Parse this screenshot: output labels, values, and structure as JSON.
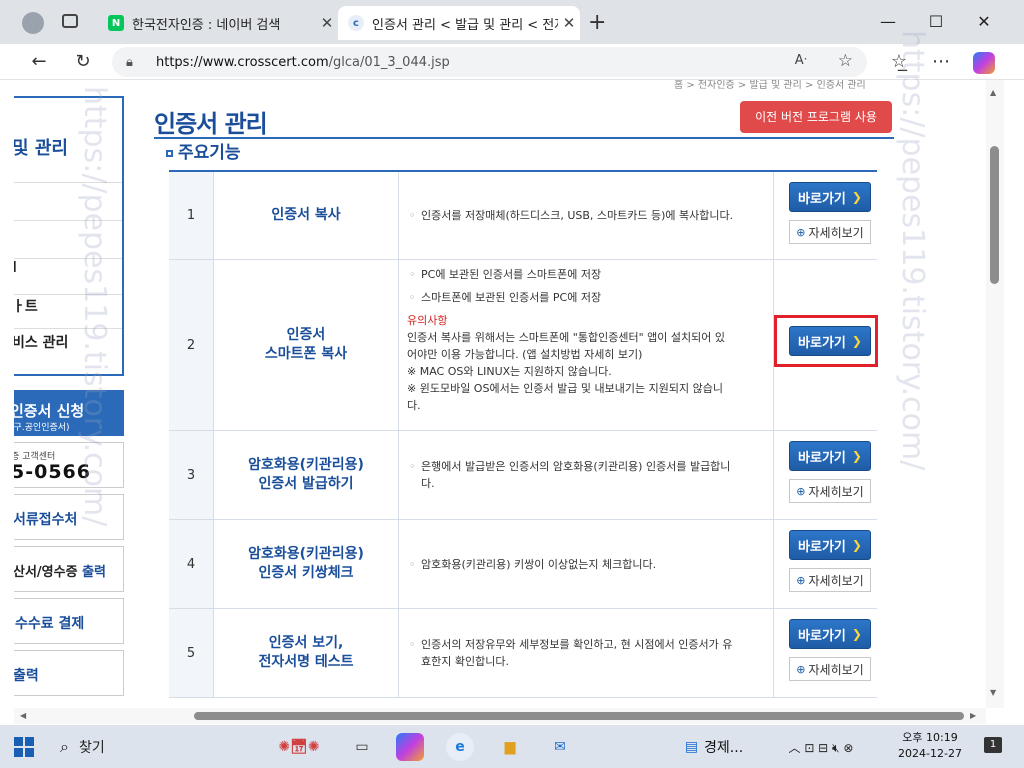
{
  "browser": {
    "tabs": [
      {
        "title": "한국전자인증 : 네이버 검색",
        "favicon": "N"
      },
      {
        "title": "인증서 관리 < 발급 및 관리 < 전자",
        "favicon": "c"
      }
    ],
    "url_host": "https://www.crosscert.com",
    "url_path": "/glca/01_3_044.jsp"
  },
  "sidebar": {
    "title": "및 관리",
    "items": [
      "l",
      "ㅏ트",
      "비스 관리"
    ],
    "apply_main": "인증서 신청",
    "apply_sub": "(구.공인인증서)",
    "cs_label": "증 고객센터",
    "cs_phone": "5-0566",
    "doc_label": "서류접수처",
    "tax_label": "산서/영수증",
    "tax_label_blue": "출력",
    "fee_label": "수수료 결제",
    "print_label": "출력"
  },
  "main": {
    "breadcrumb": "홈 > 전자인증 > 발급 및 관리 > 인증서 관리",
    "title": "인증서 관리",
    "old_version_button": "이전 버전 프로그램 사용",
    "section_title": "주요기능",
    "go_label": "바로가기",
    "detail_label": "자세히보기",
    "rows": [
      {
        "no": "1",
        "name": [
          "인증서 복사"
        ],
        "bullets": [
          "인증서를 저장매체(하드디스크, USB, 스마트카드 등)에 복사합니다."
        ]
      },
      {
        "no": "2",
        "name": [
          "인증서",
          "스마트폰 복사"
        ],
        "bullets": [
          "PC에 보관된 인증서를 스마트폰에 저장",
          "스마트폰에 보관된 인증서를 PC에 저장"
        ],
        "warn_title": "유의사항",
        "warn_lines": [
          "인증서 복사를 위해서는 스마트폰에 \"통합인증센터\" 앱이 설치되어 있",
          "어야만 이용 가능합니다. (앱 설치방법 자세히 보기)",
          "※ MAC OS와 LINUX는 지원하지 않습니다.",
          "※ 윈도모바일 OS에서는 인증서 발급 및 내보내기는 지원되지 않습니",
          "다."
        ]
      },
      {
        "no": "3",
        "name": [
          "암호화용(키관리용)",
          "인증서 발급하기"
        ],
        "bullets": [
          "은행에서 발급받은 인증서의 암호화용(키관리용) 인증서를 발급합니",
          "다."
        ]
      },
      {
        "no": "4",
        "name": [
          "암호화용(키관리용)",
          "인증서 키쌍체크"
        ],
        "bullets": [
          "암호화용(키관리용) 키쌍이 이상없는지 체크합니다."
        ]
      },
      {
        "no": "5",
        "name": [
          "인증서 보기,",
          "전자서명 테스트"
        ],
        "bullets": [
          "인증서의 저장유무와 세부정보를 확인하고, 현 시점에서 인증서가 유",
          "효한지 확인합니다."
        ]
      }
    ]
  },
  "watermarks": [
    "https://pepes119.tistory.com/",
    "https://pepes119.tistory.com/"
  ],
  "taskbar": {
    "search": "찾기",
    "app_label": "경제...",
    "time": "오후 10:19",
    "date": "2024-12-27",
    "notif_count": "1"
  },
  "colors": {
    "brand_blue": "#1a4e9a",
    "highlight_red": "#e0202a",
    "old_btn_red": "#e04a4a"
  }
}
